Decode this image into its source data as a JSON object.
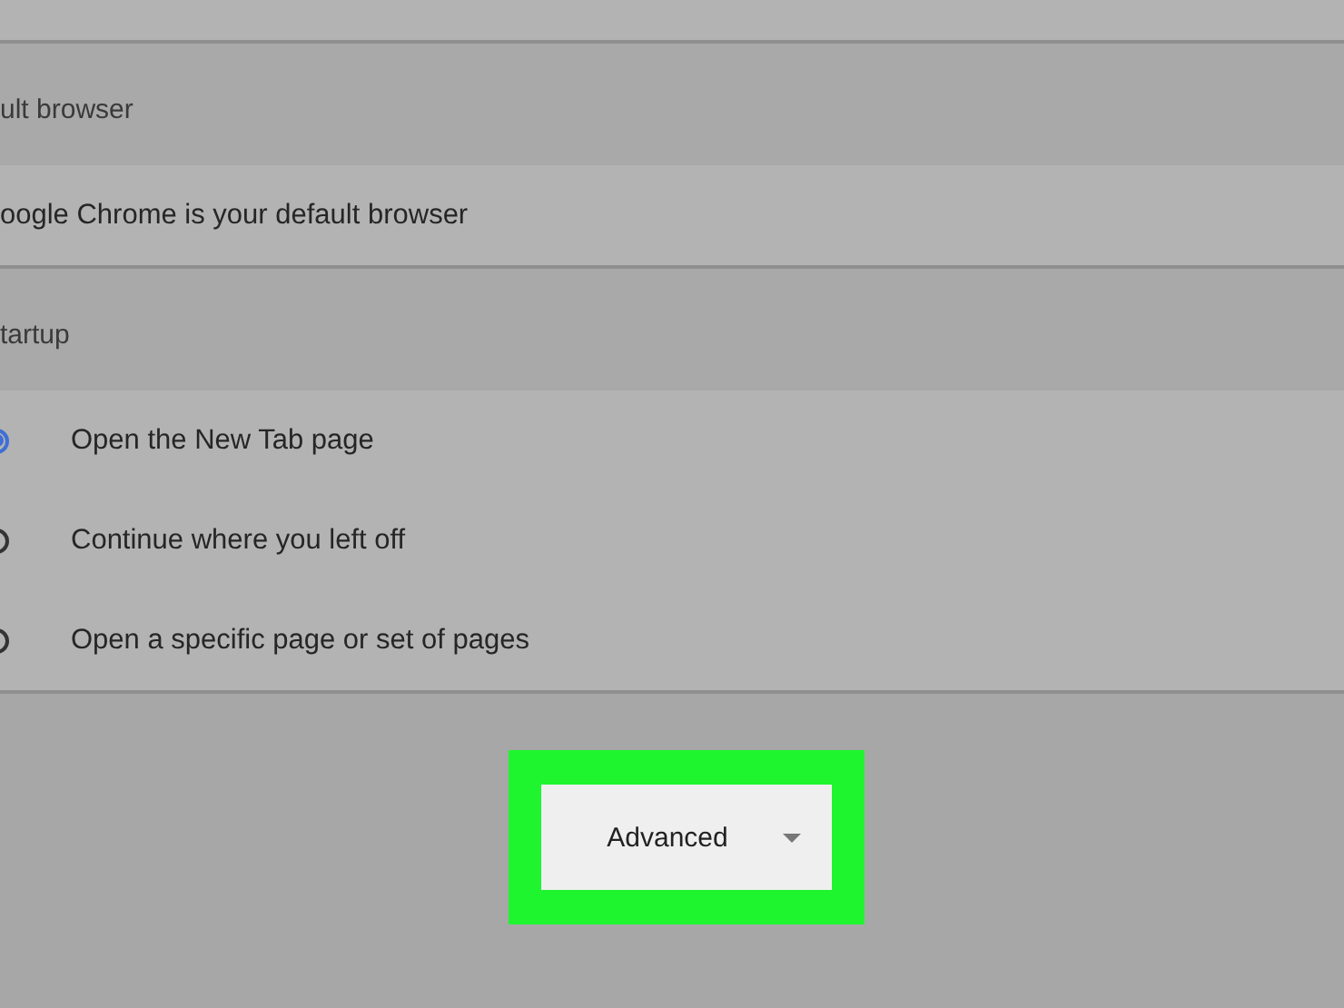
{
  "sections": [
    {
      "heading": "ult browser",
      "kind": "text",
      "rows": [
        {
          "text": "oogle Chrome is your default browser"
        }
      ]
    },
    {
      "heading": "tartup",
      "kind": "radio",
      "rows": [
        {
          "text": "Open the New Tab page",
          "selected": true
        },
        {
          "text": "Continue where you left off",
          "selected": false
        },
        {
          "text": "Open a specific page or set of pages",
          "selected": false
        }
      ]
    }
  ],
  "advanced_button": {
    "label": "Advanced",
    "highlighted": true
  }
}
